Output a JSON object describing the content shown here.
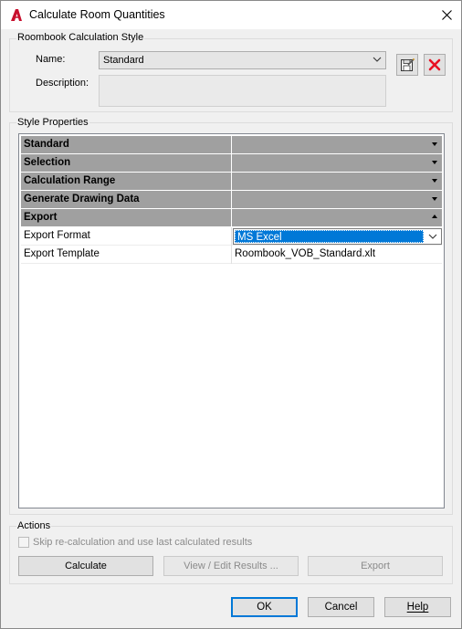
{
  "window": {
    "title": "Calculate Room Quantities",
    "app_icon": "autocad-a-icon"
  },
  "style_group": {
    "title": "Roombook Calculation Style",
    "name_label": "Name:",
    "name_value": "Standard",
    "description_label": "Description:",
    "description_value": "",
    "save_icon": "save-edit-icon",
    "delete_icon": "red-x-icon"
  },
  "properties": {
    "title": "Style Properties",
    "categories": [
      {
        "label": "Standard",
        "state": "collapsed"
      },
      {
        "label": "Selection",
        "state": "collapsed"
      },
      {
        "label": "Calculation Range",
        "state": "collapsed"
      },
      {
        "label": "Generate Drawing Data",
        "state": "collapsed"
      },
      {
        "label": "Export",
        "state": "expanded"
      }
    ],
    "rows": [
      {
        "name": "Export Format",
        "value": "MS Excel"
      },
      {
        "name": "Export Template",
        "value": "Roombook_VOB_Standard.xlt"
      }
    ]
  },
  "actions": {
    "title": "Actions",
    "skip_label": "Skip re-calculation and use last calculated results",
    "skip_checked": false,
    "calculate_label": "Calculate",
    "view_edit_label": "View / Edit Results ...",
    "export_label": "Export"
  },
  "dialog_buttons": {
    "ok": "OK",
    "cancel": "Cancel",
    "help": "Help"
  },
  "colors": {
    "selection": "#0078d7",
    "category_bg": "#a0a0a0",
    "delete_red": "#e81123",
    "app_icon_red": "#c8102e"
  }
}
